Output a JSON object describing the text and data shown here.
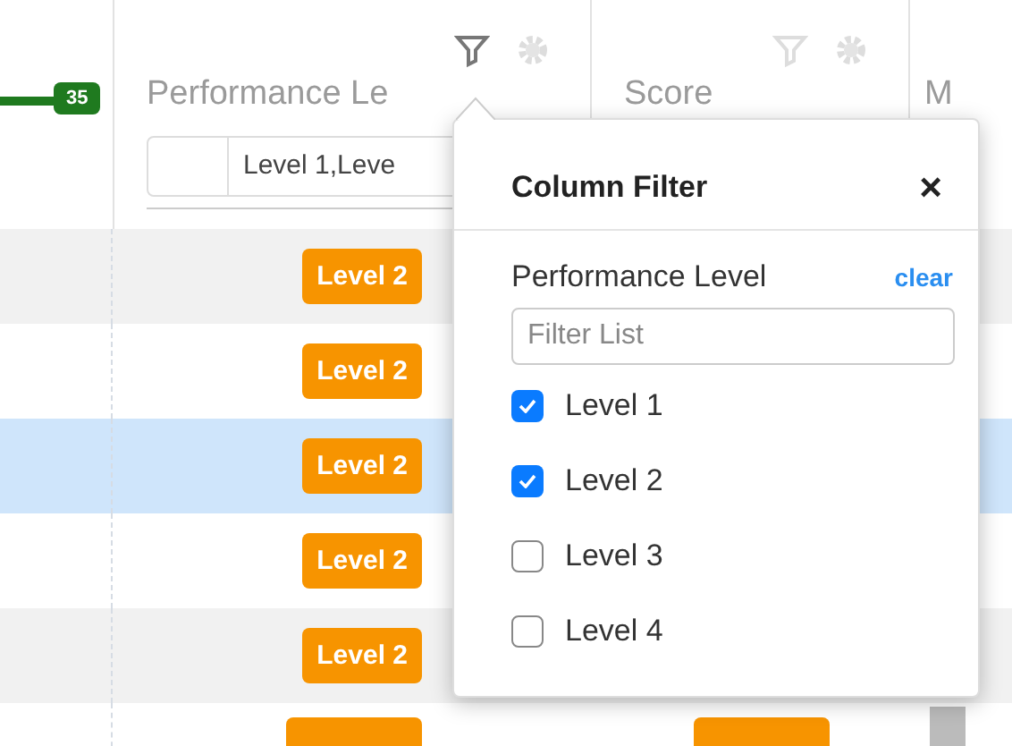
{
  "table": {
    "tag": "35",
    "columns": [
      {
        "title": "Performance Le",
        "filter_value": "Level 1,Leve"
      },
      {
        "title": "Score"
      },
      {
        "title": "M"
      }
    ],
    "rows": [
      {
        "level": "Level 2",
        "selected": false
      },
      {
        "level": "Level 2",
        "selected": false
      },
      {
        "level": "Level 2",
        "selected": true
      },
      {
        "level": "Level 2",
        "selected": false
      },
      {
        "level": "Level 2",
        "selected": false
      }
    ]
  },
  "popover": {
    "title": "Column Filter",
    "close": "×",
    "field_label": "Performance Level",
    "clear": "clear",
    "search": {
      "placeholder": "Filter List"
    },
    "options": [
      {
        "label": "Level 1",
        "checked": true
      },
      {
        "label": "Level 2",
        "checked": true
      },
      {
        "label": "Level 3",
        "checked": false
      },
      {
        "label": "Level 4",
        "checked": false
      }
    ]
  }
}
